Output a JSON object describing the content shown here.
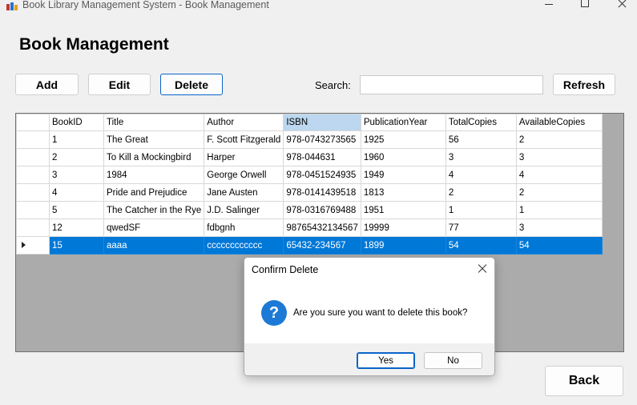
{
  "window": {
    "title": "Book Library Management System - Book Management"
  },
  "page": {
    "heading": "Book Management"
  },
  "toolbar": {
    "add_label": "Add",
    "edit_label": "Edit",
    "delete_label": "Delete",
    "search_label": "Search:",
    "search_value": "",
    "refresh_label": "Refresh"
  },
  "grid": {
    "columns": [
      "BookID",
      "Title",
      "Author",
      "ISBN",
      "PublicationYear",
      "TotalCopies",
      "AvailableCopies"
    ],
    "sorted_column": "ISBN",
    "rows": [
      [
        "1",
        "The Great",
        "F. Scott Fitzgerald",
        "978-0743273565",
        "1925",
        "56",
        "2"
      ],
      [
        "2",
        "To Kill a Mockingbird",
        "Harper",
        "978-044631",
        "1960",
        "3",
        "3"
      ],
      [
        "3",
        "1984",
        "George Orwell",
        "978-0451524935",
        "1949",
        "4",
        "4"
      ],
      [
        "4",
        "Pride and Prejudice",
        "Jane Austen",
        "978-0141439518",
        "1813",
        "2",
        "2"
      ],
      [
        "5",
        "The Catcher in the Rye",
        "J.D. Salinger",
        "978-0316769488",
        "1951",
        "1",
        "1"
      ],
      [
        "12",
        "qwedSF",
        "fdbgnh",
        "98765432134567",
        "19999",
        "77",
        "3"
      ],
      [
        "15",
        "aaaa",
        "cccccccccccc",
        "65432-234567",
        "1899",
        "54",
        "54"
      ]
    ],
    "selected_row": 6
  },
  "dialog": {
    "title": "Confirm Delete",
    "message": "Are you sure you want to delete this book?",
    "icon": "question-icon",
    "yes_label": "Yes",
    "no_label": "No"
  },
  "footer": {
    "back_label": "Back"
  },
  "colors": {
    "selection": "#0078d7",
    "accent": "#1c7ad6",
    "sorted_header": "#bcd7ef"
  }
}
